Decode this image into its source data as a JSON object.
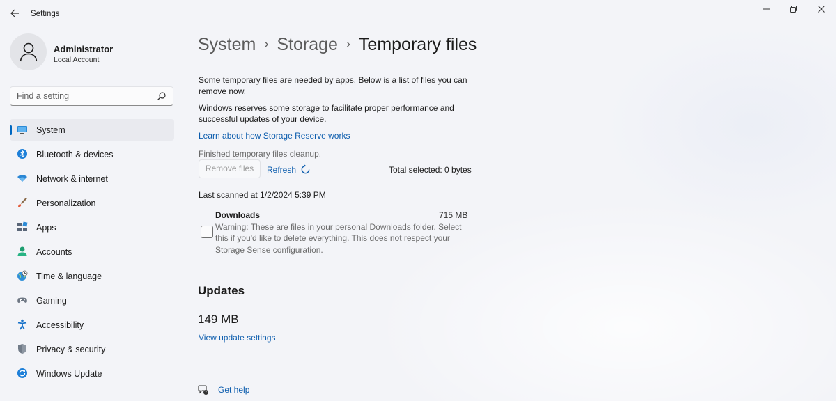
{
  "window": {
    "app_title": "Settings",
    "controls": {
      "minimize": "—",
      "maximize": "❐",
      "close": "✕"
    }
  },
  "account": {
    "name": "Administrator",
    "type": "Local Account"
  },
  "search": {
    "placeholder": "Find a setting"
  },
  "sidebar": {
    "items": [
      {
        "label": "System",
        "icon": "monitor-icon",
        "active": true
      },
      {
        "label": "Bluetooth & devices",
        "icon": "bluetooth-icon"
      },
      {
        "label": "Network & internet",
        "icon": "wifi-icon"
      },
      {
        "label": "Personalization",
        "icon": "brush-icon"
      },
      {
        "label": "Apps",
        "icon": "apps-icon"
      },
      {
        "label": "Accounts",
        "icon": "person-icon"
      },
      {
        "label": "Time & language",
        "icon": "globe-clock-icon"
      },
      {
        "label": "Gaming",
        "icon": "gamepad-icon"
      },
      {
        "label": "Accessibility",
        "icon": "accessibility-icon"
      },
      {
        "label": "Privacy & security",
        "icon": "shield-icon"
      },
      {
        "label": "Windows Update",
        "icon": "update-icon"
      }
    ]
  },
  "breadcrumb": {
    "items": [
      "System",
      "Storage"
    ],
    "current": "Temporary files",
    "separator": "›"
  },
  "content": {
    "intro": "Some temporary files are needed by apps. Below is a list of files you can remove now.",
    "reserve_text": "Windows reserves some storage to facilitate proper performance and successful updates of your device.",
    "reserve_link": "Learn about how Storage Reserve works",
    "cleanup_status": "Finished temporary files cleanup.",
    "remove_button": "Remove files",
    "refresh_button": "Refresh",
    "total_selected": "Total selected: 0 bytes",
    "last_scanned": "Last scanned at 1/2/2024 5:39 PM",
    "downloads": {
      "title": "Downloads",
      "size": "715 MB",
      "description": "Warning: These are files in your personal Downloads folder. Select this if you'd like to delete everything. This does not respect your Storage Sense configuration.",
      "checked": false
    },
    "updates": {
      "title": "Updates",
      "size": "149 MB",
      "link": "View update settings"
    },
    "help_link": "Get help"
  },
  "colors": {
    "accent": "#0067c0",
    "link": "#0b5cad",
    "background": "#f3f4f8"
  }
}
